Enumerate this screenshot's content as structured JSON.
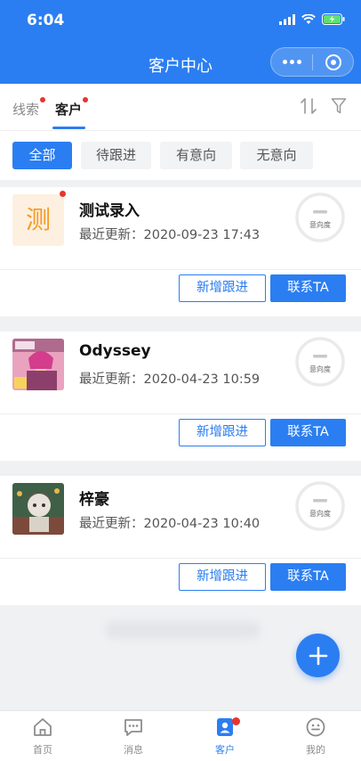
{
  "status_bar": {
    "time": "6:04"
  },
  "nav": {
    "title": "客户中心"
  },
  "tabs": [
    {
      "label": "线索",
      "has_dot": true
    },
    {
      "label": "客户",
      "has_dot": true,
      "active": true
    }
  ],
  "filters": [
    {
      "label": "全部",
      "active": true
    },
    {
      "label": "待跟进"
    },
    {
      "label": "有意向"
    },
    {
      "label": "无意向"
    }
  ],
  "customers": [
    {
      "name": "测试录入",
      "avatar_text": "测",
      "updated": "最近更新：2020-09-23 17:43",
      "gauge_label": "意向度",
      "has_dot": true,
      "follow_label": "新增跟进",
      "contact_label": "联系TA"
    },
    {
      "name": "Odyssey",
      "avatar_text": "",
      "updated": "最近更新：2020-04-23 10:59",
      "gauge_label": "意向度",
      "follow_label": "新增跟进",
      "contact_label": "联系TA"
    },
    {
      "name": "梓豪",
      "avatar_text": "",
      "updated": "最近更新：2020-04-23 10:40",
      "gauge_label": "意向度",
      "follow_label": "新增跟进",
      "contact_label": "联系TA"
    }
  ],
  "tabbar": [
    {
      "label": "首页",
      "icon": "home-icon"
    },
    {
      "label": "消息",
      "icon": "message-icon"
    },
    {
      "label": "客户",
      "icon": "customer-icon",
      "active": true,
      "badge": true
    },
    {
      "label": "我的",
      "icon": "profile-icon"
    }
  ],
  "colors": {
    "primary": "#2b7ef1",
    "badge": "#e8342f",
    "avatar_accent": "#f59a23"
  }
}
